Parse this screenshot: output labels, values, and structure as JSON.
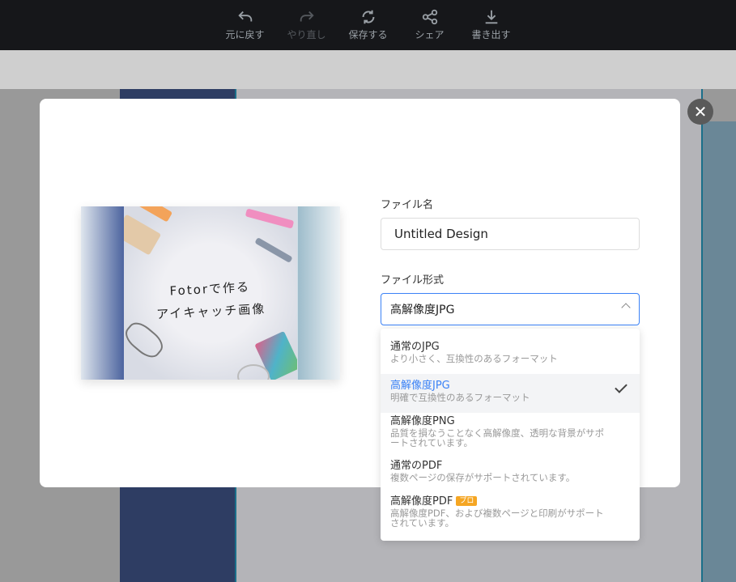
{
  "toolbar": {
    "items": [
      {
        "label": "元に戻す",
        "icon": "undo-icon"
      },
      {
        "label": "やり直し",
        "icon": "redo-icon",
        "disabled": true
      },
      {
        "label": "保存する",
        "icon": "sync-icon"
      },
      {
        "label": "シェア",
        "icon": "share-icon"
      },
      {
        "label": "書き出す",
        "icon": "download-icon"
      }
    ]
  },
  "modal": {
    "preview_text": [
      "Fotorで作る",
      "アイキャッチ画像"
    ],
    "file_name_label": "ファイル名",
    "file_name_value": "Untitled Design",
    "file_format_label": "ファイル形式",
    "file_format_value": "高解像度JPG",
    "options": [
      {
        "title": "通常のJPG",
        "desc": "より小さく、互換性のあるフォーマット"
      },
      {
        "title": "高解像度JPG",
        "desc": "明確で互換性のあるフォーマット",
        "selected": true
      },
      {
        "title": "高解像度PNG",
        "desc": "品質を損なうことなく高解像度、透明な背景がサポートされています。"
      },
      {
        "title": "通常のPDF",
        "desc": "複数ページの保存がサポートされています。"
      },
      {
        "title": "高解像度PDF",
        "badge": "プロ",
        "desc": "高解像度PDF、および複数ページと印刷がサポートされています。"
      }
    ],
    "close_icon": "close-icon"
  },
  "colors": {
    "accent": "#3b82f6",
    "pro_badge": "#f5a623",
    "toolbar_bg": "#16171a"
  }
}
